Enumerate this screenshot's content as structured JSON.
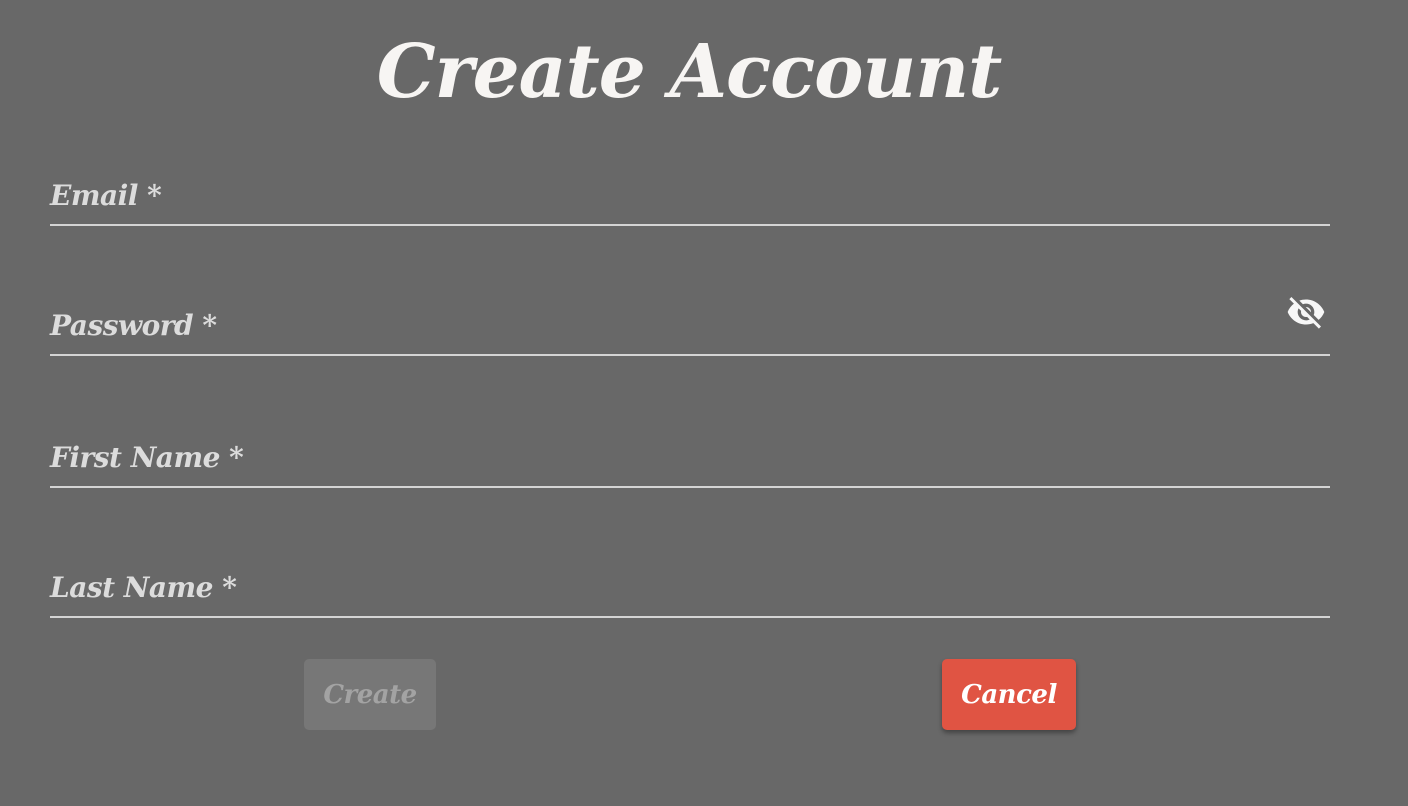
{
  "title": "Create Account",
  "fields": {
    "email": {
      "label": "Email *",
      "value": ""
    },
    "password": {
      "label": "Password *",
      "value": "",
      "toggle_icon": "visibility-off-icon"
    },
    "first_name": {
      "label": "First Name *",
      "value": ""
    },
    "last_name": {
      "label": "Last Name *",
      "value": ""
    }
  },
  "buttons": {
    "create": {
      "label": "Create",
      "disabled": true
    },
    "cancel": {
      "label": "Cancel"
    }
  },
  "colors": {
    "background": "#686868",
    "cancel": "#e05443",
    "create_disabled": "#777777"
  }
}
